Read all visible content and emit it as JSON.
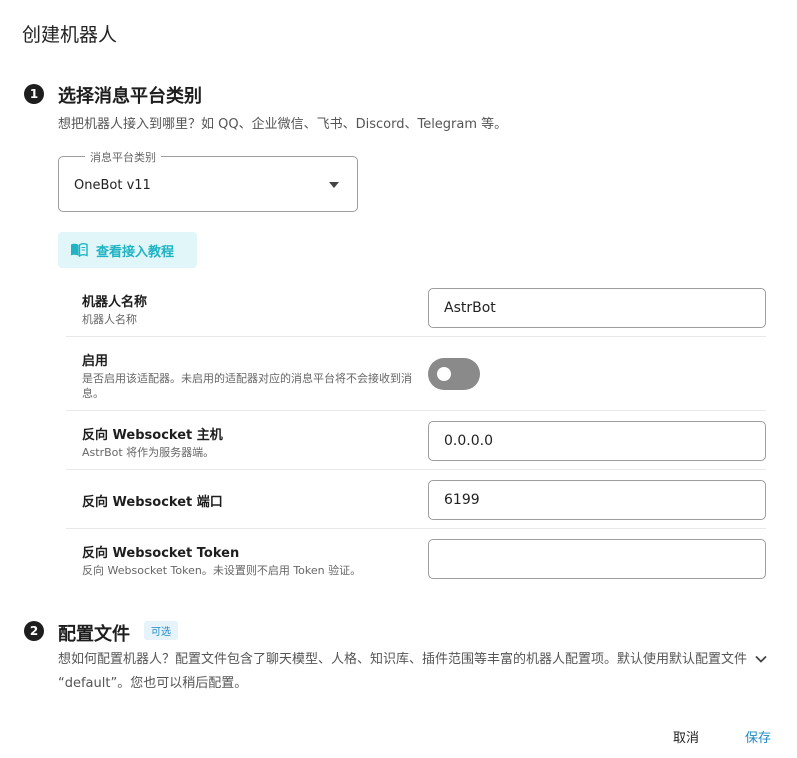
{
  "dialog": {
    "title": "创建机器人"
  },
  "step1": {
    "number": "1",
    "title": "选择消息平台类别",
    "description": "想把机器人接入到哪里？如 QQ、企业微信、飞书、Discord、Telegram 等。",
    "platform_select": {
      "legend": "消息平台类别",
      "value": "OneBot v11"
    },
    "tutorial_button": {
      "label": "查看接入教程",
      "icon": "book-icon"
    }
  },
  "fields": {
    "bot_name": {
      "label": "机器人名称",
      "hint": "机器人名称",
      "value": "AstrBot"
    },
    "enable": {
      "label": "启用",
      "hint": "是否启用该适配器。未启用的适配器对应的消息平台将不会接收到消息。",
      "value": false
    },
    "ws_host": {
      "label": "反向 Websocket 主机",
      "hint": "AstrBot 将作为服务器端。",
      "value": "0.0.0.0"
    },
    "ws_port": {
      "label": "反向 Websocket 端口",
      "value": "6199"
    },
    "ws_token": {
      "label": "反向 Websocket Token",
      "hint": "反向 Websocket Token。未设置则不启用 Token 验证。",
      "value": ""
    }
  },
  "step2": {
    "number": "2",
    "title": "配置文件",
    "badge": "可选",
    "description": "想如何配置机器人？配置文件包含了聊天模型、人格、知识库、插件范围等丰富的机器人配置项。默认使用默认配置文件 “default”。您也可以稍后配置。"
  },
  "footer": {
    "cancel_label": "取消",
    "save_label": "保存"
  },
  "colors": {
    "accent": "#1fb3c4",
    "primary": "#1f8ac4",
    "toggle_off": "#8a8a8a"
  }
}
